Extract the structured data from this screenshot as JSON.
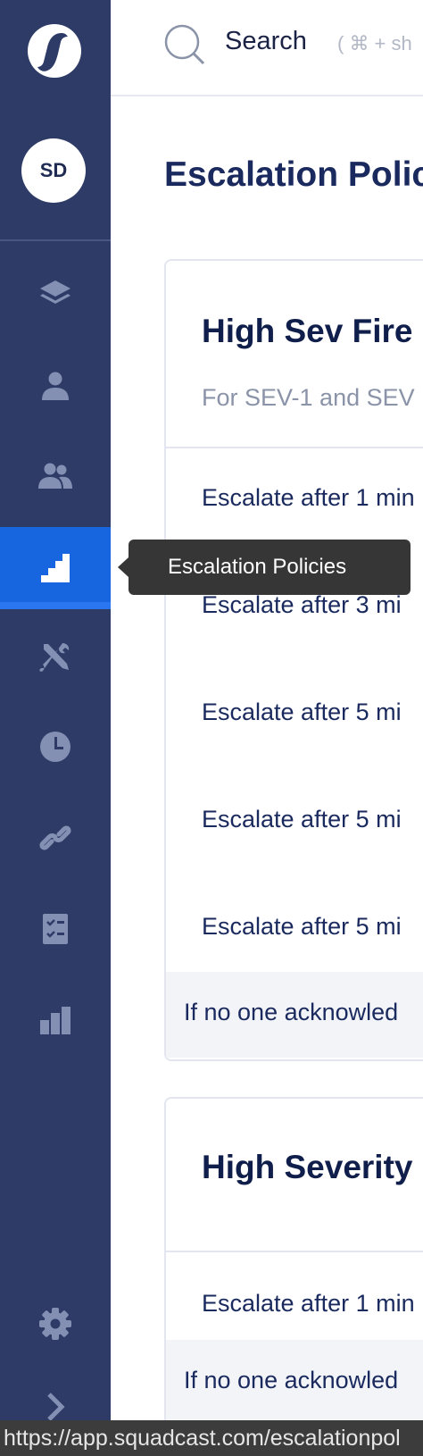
{
  "sidebar": {
    "avatar_initials": "SD",
    "active_item": "escalation-policies",
    "items": [
      {
        "id": "services",
        "icon": "layers-icon"
      },
      {
        "id": "user",
        "icon": "user-icon"
      },
      {
        "id": "squads",
        "icon": "users-icon"
      },
      {
        "id": "escalation-policies",
        "icon": "stairs-icon"
      },
      {
        "id": "integrations",
        "icon": "tools-icon"
      },
      {
        "id": "schedules",
        "icon": "clock-icon"
      },
      {
        "id": "webhooks",
        "icon": "link-icon"
      },
      {
        "id": "tasks",
        "icon": "checklist-icon"
      },
      {
        "id": "analytics",
        "icon": "bar-chart-icon"
      },
      {
        "id": "settings",
        "icon": "gear-icon"
      },
      {
        "id": "expand",
        "icon": "chevron-right-icon"
      }
    ],
    "tooltip": "Escalation Policies"
  },
  "search": {
    "label": "Search",
    "hint": "( ⌘ + sh"
  },
  "page": {
    "title": "Escalation Polic"
  },
  "policies": [
    {
      "title": "High Sev Fire",
      "description": "For SEV-1 and SEV",
      "rules": [
        "Escalate after 1 min",
        "Escalate after 3 mi",
        "Escalate after 5 mi",
        "Escalate after 5 mi",
        "Escalate after 5 mi"
      ],
      "footer": "If no one acknowled"
    },
    {
      "title": "High Severity",
      "rules": [
        "Escalate after 1 min"
      ],
      "footer": "If no one acknowled"
    }
  ],
  "status_url": "https://app.squadcast.com/escalationpol",
  "colors": {
    "sidebar_bg": "#2d3b66",
    "active_item": "#1766e0",
    "icon_muted": "#8390b4"
  }
}
